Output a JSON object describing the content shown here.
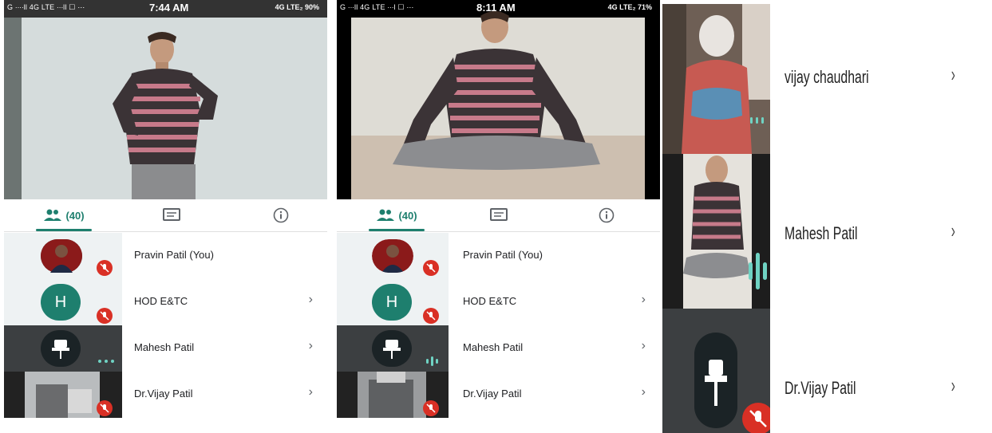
{
  "panel1": {
    "status": {
      "carrier": "G ∙∙∙∙ll 4G LTE ∙∙∙ll ☐ ⋯",
      "time": "7:44 AM",
      "right": "4G LTE₂ 90%"
    },
    "tabs": {
      "participants_label": "(40)"
    },
    "participants": [
      {
        "name": "Pravin Patil (You)",
        "has_chevron": false
      },
      {
        "name": "HOD E&TC",
        "avatar_letter": "H",
        "has_chevron": true
      },
      {
        "name": "Mahesh Patil",
        "has_chevron": true
      },
      {
        "name": "Dr.Vijay Patil",
        "has_chevron": true
      }
    ]
  },
  "panel2": {
    "status": {
      "carrier": "G ∙∙∙ll 4G LTE ∙∙∙l ☐ ⋯",
      "time": "8:11 AM",
      "right": "4G LTE₂ 71%"
    },
    "tabs": {
      "participants_label": "(40)"
    },
    "participants": [
      {
        "name": "Pravin Patil (You)",
        "has_chevron": false
      },
      {
        "name": "HOD E&TC",
        "avatar_letter": "H",
        "has_chevron": true
      },
      {
        "name": "Mahesh Patil",
        "has_chevron": true
      },
      {
        "name": "Dr.Vijay Patil",
        "has_chevron": true
      }
    ]
  },
  "panel3": {
    "participants": [
      {
        "name": "vijay chaudhari"
      },
      {
        "name": "Mahesh Patil"
      },
      {
        "name": "Dr.Vijay Patil"
      }
    ]
  },
  "chevron": "›",
  "colors": {
    "accent": "#1e7f6e",
    "mic_off": "#d93025",
    "avatar_green": "#1e7f6e"
  },
  "icons": [
    "people-icon",
    "chat-icon",
    "info-icon",
    "mic-off-icon",
    "pin-icon",
    "chevron-right-icon",
    "audio-level-icon"
  ]
}
